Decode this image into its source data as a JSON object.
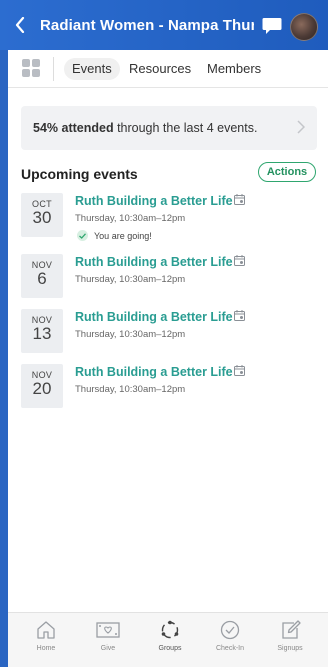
{
  "header": {
    "title": "Radiant Women - Nampa Thursd..."
  },
  "tabs": [
    {
      "label": "Events",
      "active": true
    },
    {
      "label": "Resources",
      "active": false
    },
    {
      "label": "Members",
      "active": false
    }
  ],
  "attendance": {
    "percent": "54% attended",
    "rest": " through the last 4 events."
  },
  "upcoming": {
    "heading": "Upcoming events",
    "actions_label": "Actions"
  },
  "events": [
    {
      "month": "OCT",
      "day": "30",
      "title": "Ruth Building a Better Life",
      "time": "Thursday, 10:30am–12pm",
      "status": "You are going!"
    },
    {
      "month": "NOV",
      "day": "6",
      "title": "Ruth Building a Better Life",
      "time": "Thursday, 10:30am–12pm"
    },
    {
      "month": "NOV",
      "day": "13",
      "title": "Ruth Building a Better Life",
      "time": "Thursday, 10:30am–12pm"
    },
    {
      "month": "NOV",
      "day": "20",
      "title": "Ruth Building a Better Life",
      "time": "Thursday, 10:30am–12pm"
    }
  ],
  "nav": [
    {
      "label": "Home",
      "icon": "home-icon"
    },
    {
      "label": "Give",
      "icon": "give-icon"
    },
    {
      "label": "Groups",
      "icon": "groups-icon",
      "active": true
    },
    {
      "label": "Check-In",
      "icon": "check-in-icon"
    },
    {
      "label": "Signups",
      "icon": "signups-icon"
    }
  ],
  "colors": {
    "header": "#2c6dd0",
    "accent_teal": "#2a9d92",
    "actions_green": "#2fa66f"
  }
}
